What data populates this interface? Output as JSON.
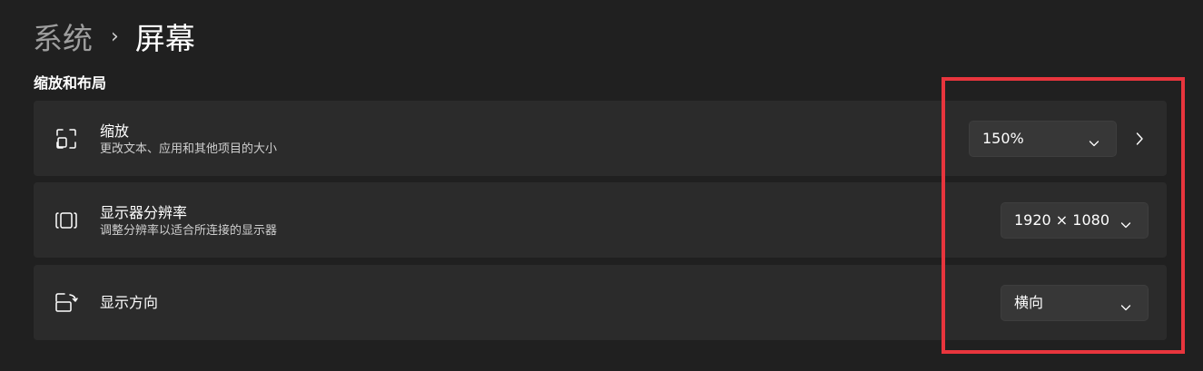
{
  "breadcrumb": {
    "parent": "系统",
    "separator": "›",
    "current": "屏幕"
  },
  "section": {
    "title": "缩放和布局"
  },
  "settings": [
    {
      "title": "缩放",
      "description": "更改文本、应用和其他项目的大小",
      "value": "150%",
      "icon": "scale-icon",
      "has_chevron": true
    },
    {
      "title": "显示器分辨率",
      "description": "调整分辨率以适合所连接的显示器",
      "value": "1920 × 1080",
      "icon": "resolution-icon"
    },
    {
      "title": "显示方向",
      "value": "横向",
      "icon": "orientation-icon"
    }
  ],
  "colors": {
    "background": "#202020",
    "card": "#2b2b2b",
    "dropdown": "#373737",
    "highlight": "#e8353d"
  }
}
